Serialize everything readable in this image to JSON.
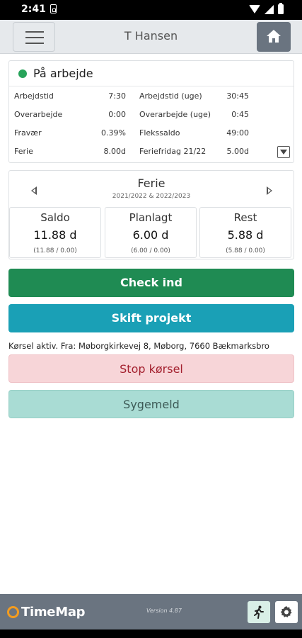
{
  "status_bar": {
    "time": "2:41"
  },
  "header": {
    "title": "T Hansen"
  },
  "status_card": {
    "status": "På arbejde",
    "status_color": "#27a35a",
    "stats": [
      {
        "label": "Arbejdstid",
        "value": "7:30"
      },
      {
        "label": "Arbejdstid (uge)",
        "value": "30:45"
      },
      {
        "label": "Overarbejde",
        "value": "0:00"
      },
      {
        "label": "Overarbejde (uge)",
        "value": "0:45"
      },
      {
        "label": "Fravær",
        "value": "0.39%"
      },
      {
        "label": "Flekssaldo",
        "value": "49:00"
      },
      {
        "label": "Ferie",
        "value": "8.00d"
      },
      {
        "label": "Feriefridag 21/22",
        "value": "5.00d"
      }
    ]
  },
  "ferie_card": {
    "title": "Ferie",
    "period": "2021/2022 & 2022/2023",
    "balances": [
      {
        "label": "Saldo",
        "value": "11.88 d",
        "detail": "(11.88 / 0.00)"
      },
      {
        "label": "Planlagt",
        "value": "6.00 d",
        "detail": "(6.00 / 0.00)"
      },
      {
        "label": "Rest",
        "value": "5.88 d",
        "detail": "(5.88 / 0.00)"
      }
    ]
  },
  "actions": {
    "check_in": "Check ind",
    "switch_project": "Skift projekt",
    "trip_text": "Kørsel aktiv. Fra: Møborgkirkevej 8, Møborg, 7660 Bækmarksbro",
    "stop_trip": "Stop kørsel",
    "report_sick": "Sygemeld"
  },
  "footer": {
    "logo": "TimeMap",
    "version": "Version 4.87"
  },
  "colors": {
    "check_in": "#1f8b53",
    "switch_project": "#1aa0b6",
    "stop_trip": "#f7d5d8",
    "report_sick": "#a9dcd4",
    "footer": "#6a7480",
    "logo_accent": "#f39c1f"
  }
}
